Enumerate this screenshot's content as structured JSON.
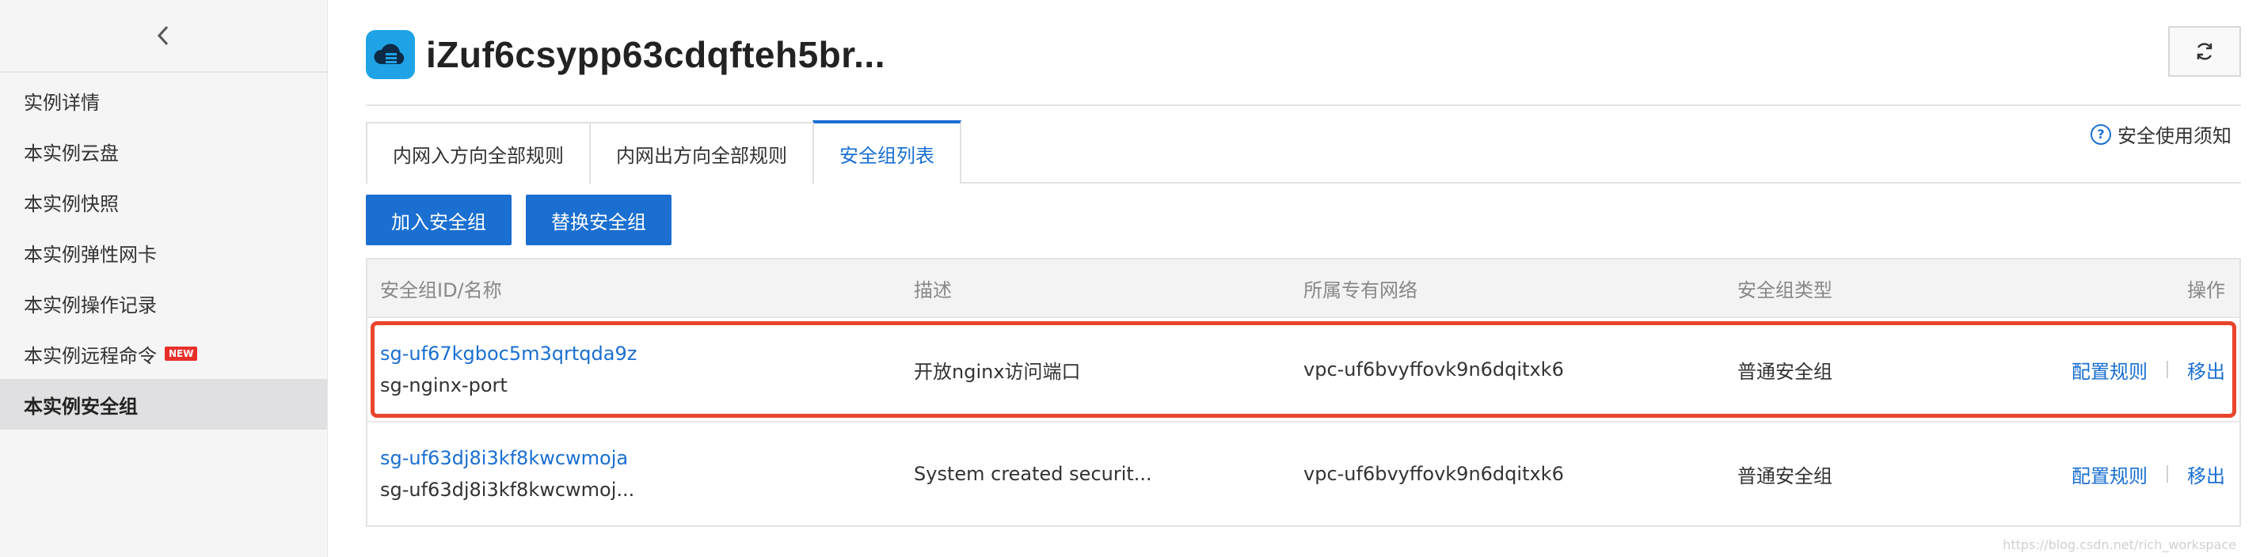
{
  "sidebar": {
    "items": [
      {
        "label": "实例详情"
      },
      {
        "label": "本实例云盘"
      },
      {
        "label": "本实例快照"
      },
      {
        "label": "本实例弹性网卡"
      },
      {
        "label": "本实例操作记录"
      },
      {
        "label": "本实例远程命令",
        "badge": "NEW"
      },
      {
        "label": "本实例安全组"
      }
    ],
    "active_index": 6
  },
  "header": {
    "title": "iZuf6csypp63cdqfteh5br...",
    "icon": "cloud-server-icon",
    "refresh_icon": "refresh-icon"
  },
  "notice": {
    "label": "安全使用须知",
    "icon": "help-circle-icon"
  },
  "tabs": [
    {
      "label": "内网入方向全部规则"
    },
    {
      "label": "内网出方向全部规则"
    },
    {
      "label": "安全组列表"
    }
  ],
  "active_tab": 2,
  "buttons": {
    "join": "加入安全组",
    "replace": "替换安全组"
  },
  "table": {
    "headers": [
      "安全组ID/名称",
      "描述",
      "所属专有网络",
      "安全组类型",
      "操作"
    ],
    "rows": [
      {
        "id": "sg-uf67kgboc5m3qrtqda9z",
        "name": "sg-nginx-port",
        "description": "开放nginx访问端口",
        "vpc": "vpc-uf6bvyffovk9n6dqitxk6",
        "type": "普通安全组",
        "action_config": "配置规则",
        "action_remove": "移出",
        "highlighted": true
      },
      {
        "id": "sg-uf63dj8i3kf8kwcwmoja",
        "name": "sg-uf63dj8i3kf8kwcwmoj...",
        "description": "System created securit...",
        "vpc": "vpc-uf6bvyffovk9n6dqitxk6",
        "type": "普通安全组",
        "action_config": "配置规则",
        "action_remove": "移出",
        "highlighted": false
      }
    ]
  },
  "colors": {
    "accent": "#1a6fd1",
    "highlight": "#e8452c",
    "badge": "#e8302b"
  },
  "watermark": "https://blog.csdn.net/rich_workspace"
}
